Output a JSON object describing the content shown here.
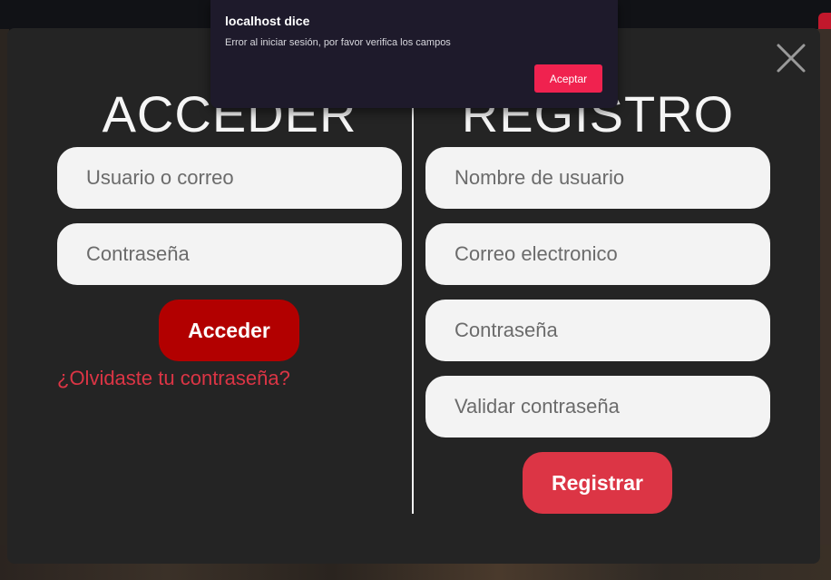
{
  "alert": {
    "title": "localhost dice",
    "message": "Error al iniciar sesión, por favor verifica los campos",
    "ok_label": "Aceptar"
  },
  "login": {
    "heading": "ACCEDER",
    "user_placeholder": "Usuario o correo",
    "password_placeholder": "Contraseña",
    "submit_label": "Acceder",
    "forgot_link": "¿Olvidaste tu contraseña?"
  },
  "register": {
    "heading": "REGISTRO",
    "username_placeholder": "Nombre de usuario",
    "email_placeholder": "Correo electronico",
    "password_placeholder": "Contraseña",
    "confirm_placeholder": "Validar contraseña",
    "submit_label": "Registrar"
  },
  "icons": {
    "close": "close-icon"
  },
  "colors": {
    "modal_bg": "#242424",
    "login_button": "#b20000",
    "register_button": "#dc3545",
    "link": "#dc3545",
    "alert_bg": "#1e1a2b",
    "alert_button": "#f0224f"
  }
}
